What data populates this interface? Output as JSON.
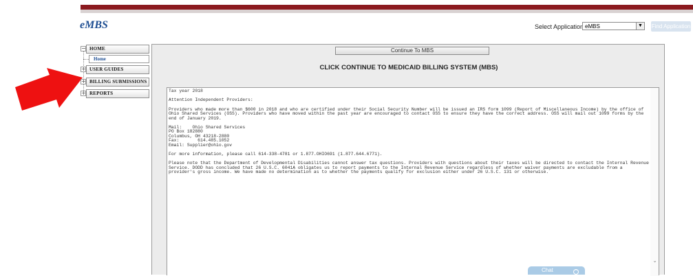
{
  "app": {
    "logo": "eMBS"
  },
  "header": {
    "select_label": "Select Application",
    "select_value": "eMBS",
    "find_button": "Find Application"
  },
  "nav": {
    "home": "HOME",
    "home_sub": "Home",
    "user_guides": "USER GUIDES",
    "billing_submissions": "BILLING SUBMISSIONS",
    "reports": "REPORTS"
  },
  "main": {
    "continue_button": "Continue To MBS",
    "heading": "CLICK CONTINUE TO MEDICAID BILLING SYSTEM (MBS)",
    "message": {
      "line1": "Tax year 2018",
      "line2": "Attention Independent Providers:",
      "para1": "Providers who made more than $600 in 2018 and who are certified under their Social Security Number will be issued an IRS form 1099 (Report of Miscellaneous Income) by the office of Ohio Shared Services (OSS). Providers who have moved within the past year are encouraged to contact OSS to ensure they have the correct address. OSS will mail out 1099 forms by the end of January 2019.",
      "mail1": "Mail:    Ohio Shared Services",
      "mail2": "PO Box 182880",
      "mail3": "Columbus, OH 43218-2880",
      "mail4": "Fax:       614.485.1052",
      "mail5": "Email: Supplier@ohio.gov",
      "info": "For more information, please call 614-338-4781 or 1.877.OHIO691 (1.877.644.6771).",
      "para2": "Please note that the Department of Developmental Disabilities cannot answer tax questions. Providers with questions about their taxes will be directed to contact the Internal Revenue Service. DODD has concluded that 26 U.S.C. 6041A obligates us to report payments to the Internal Revenue Service regardless of whether waiver payments are excludable from a provider's gross income. We have made no determination as to whether the payments qualify for exclusion either under 26 U.S.C. 131 or otherwise."
    }
  },
  "floating_button": {
    "label": "Chat"
  },
  "colors": {
    "top_bar": "#8b1a1f",
    "logo": "#1f4f93",
    "arrow": "#ee1111"
  },
  "icons": {
    "arrow": "red-arrow-icon",
    "scroll": "chevron-down-icon"
  }
}
